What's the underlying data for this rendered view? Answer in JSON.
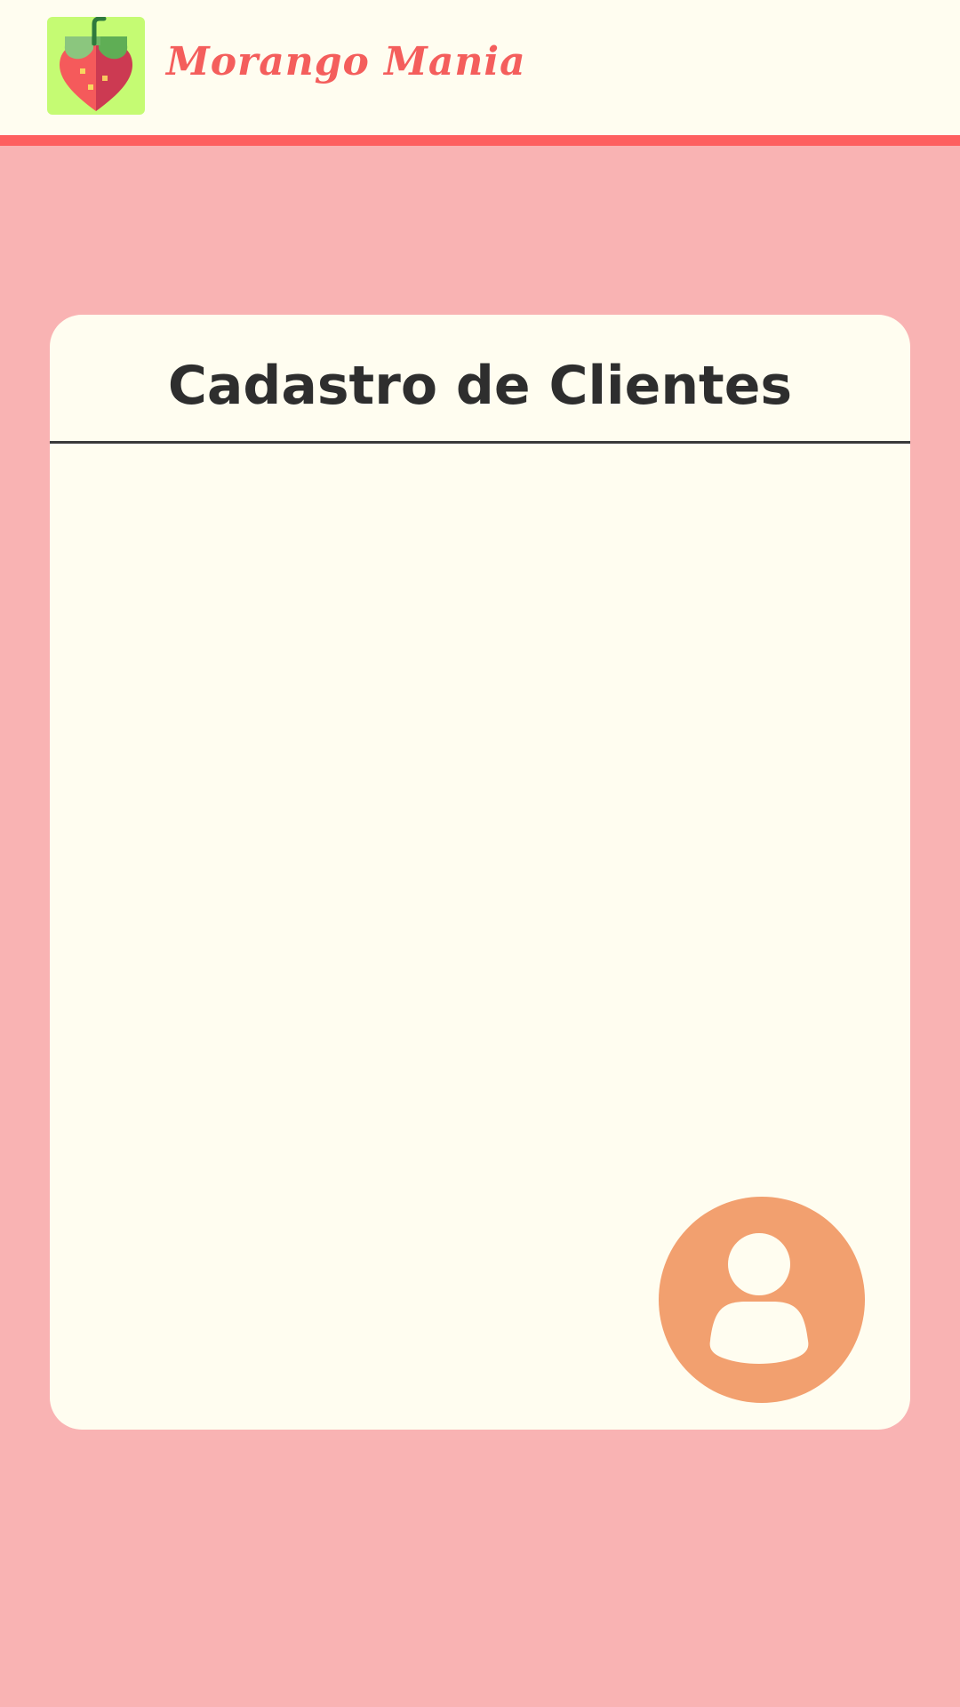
{
  "app": {
    "name": "Morango Mania",
    "logo_icon": "strawberry-icon"
  },
  "page": {
    "title": "Cadastro de Clientes"
  },
  "clients": [],
  "actions": {
    "add_client_icon": "user-avatar-icon"
  },
  "colors": {
    "background": "#f9b3b3",
    "header_background": "#fffdf0",
    "accent_stripe": "#fe5f5f",
    "brand_text": "#f45e5c",
    "logo_background": "#c5fb73",
    "card_background": "#fffdf0",
    "title_text": "#2e2e2e",
    "action_button": "#f2a06f"
  }
}
